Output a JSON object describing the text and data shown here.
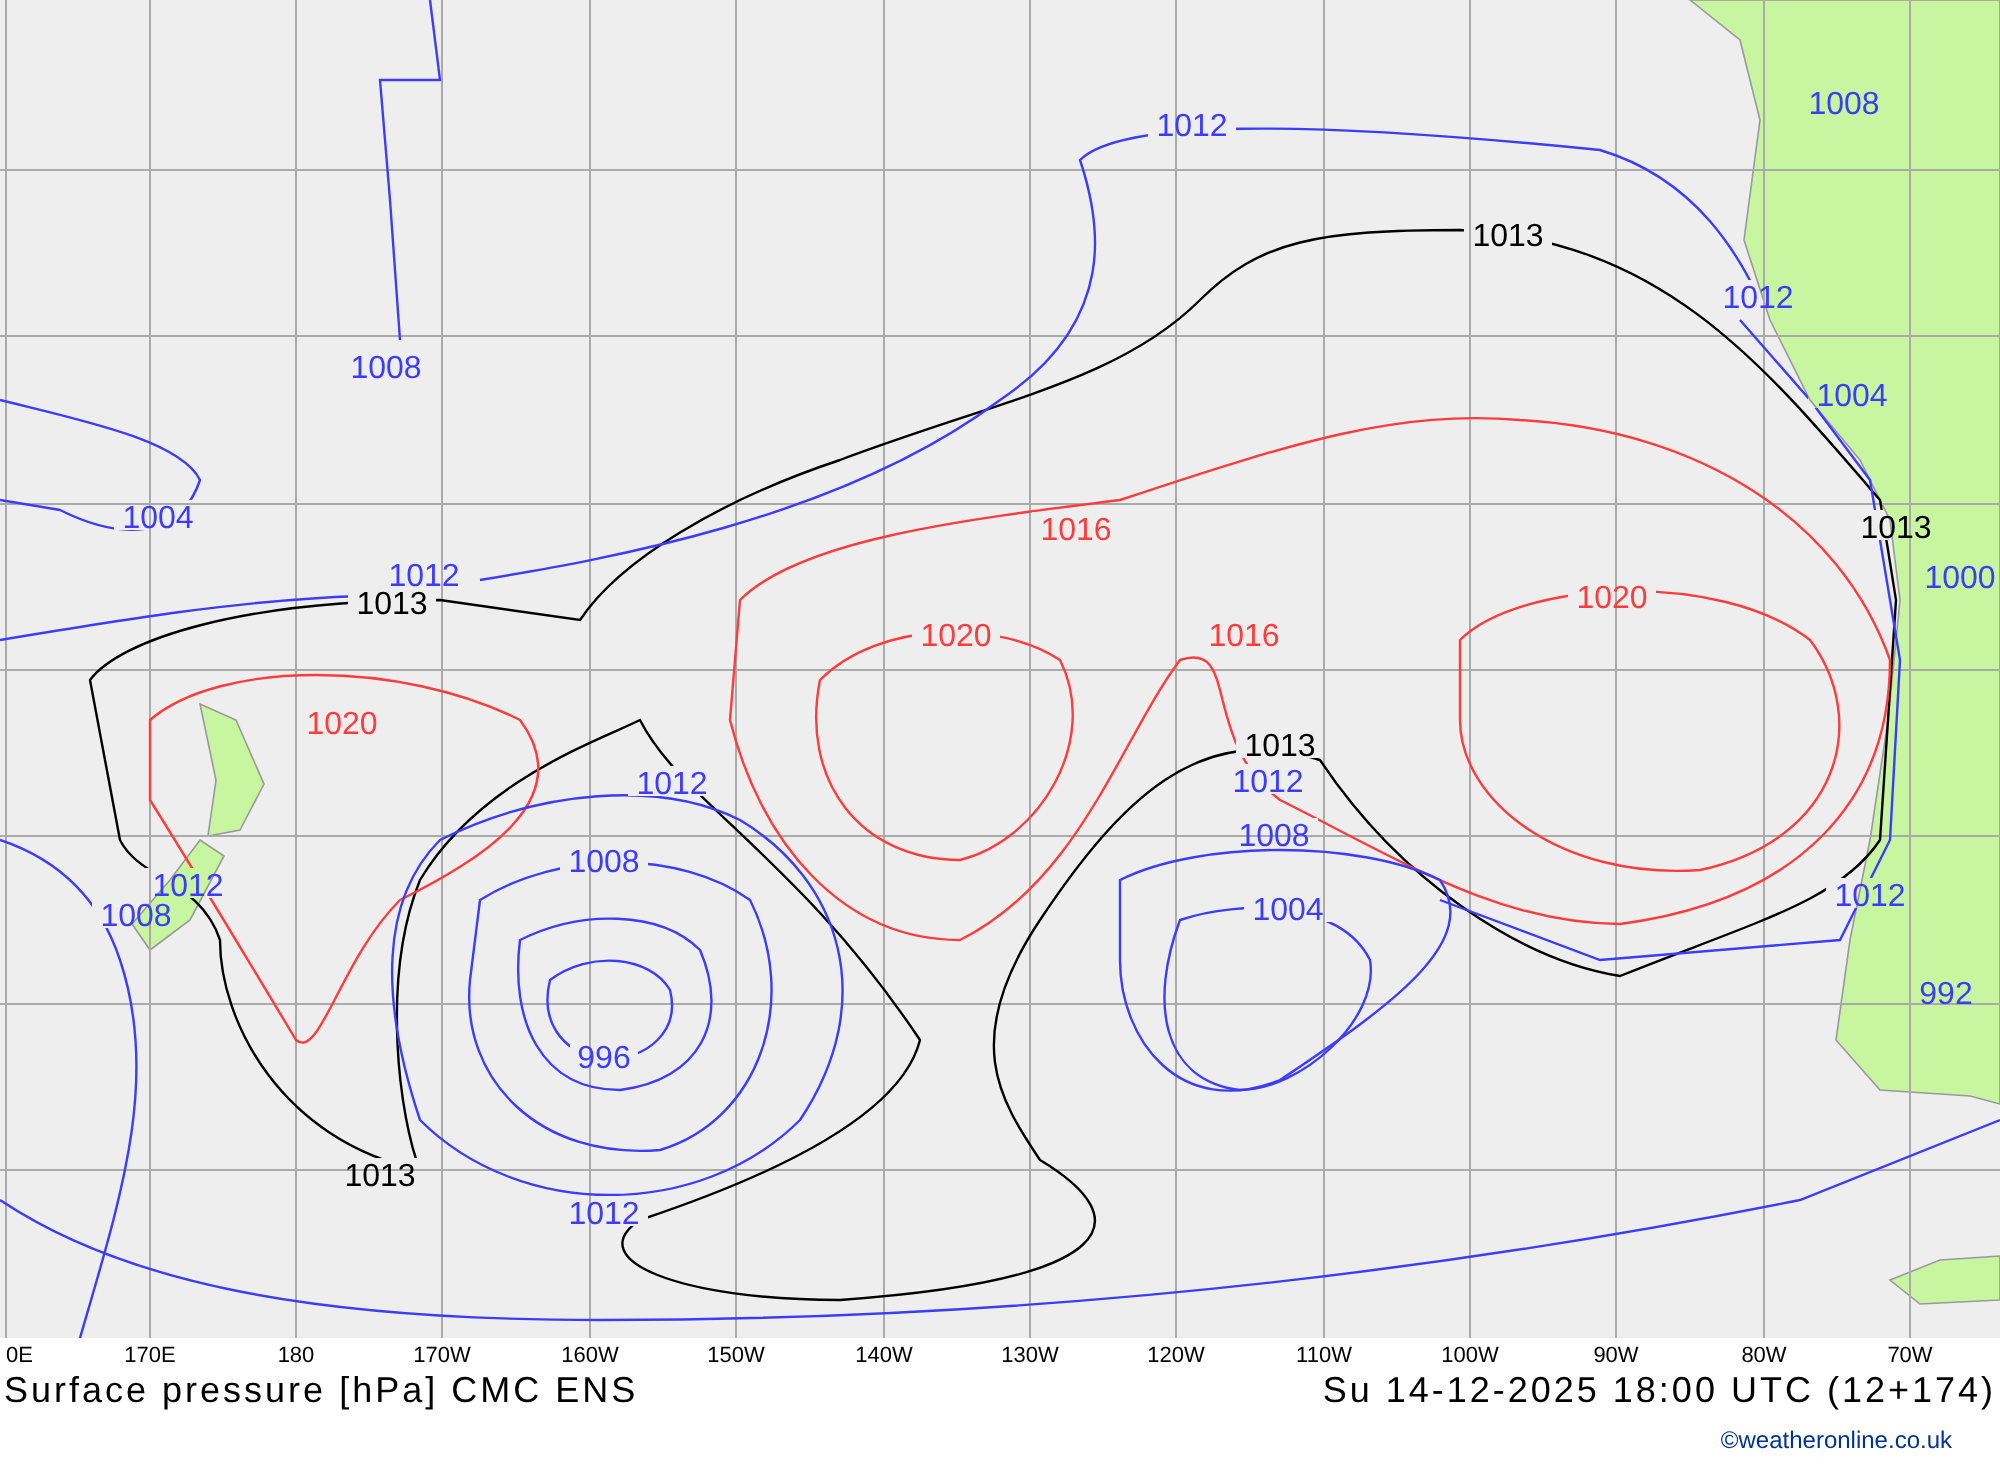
{
  "map": {
    "isobar_labels": [
      {
        "text": "1012",
        "color": "#3c3cff"
      },
      {
        "text": "1008",
        "color": "#3c3cff"
      },
      {
        "text": "1013",
        "color": "#000000"
      },
      {
        "text": "1012",
        "color": "#3c3cff"
      },
      {
        "text": "1008",
        "color": "#3c3cff"
      },
      {
        "text": "1004",
        "color": "#3c3cff"
      },
      {
        "text": "1004",
        "color": "#3c3cff"
      },
      {
        "text": "1016",
        "color": "#ff3c3c"
      },
      {
        "text": "1013",
        "color": "#000000"
      },
      {
        "text": "1012",
        "color": "#3c3cff"
      },
      {
        "text": "1000",
        "color": "#3c3cff"
      },
      {
        "text": "1020",
        "color": "#ff3c3c"
      },
      {
        "text": "1013",
        "color": "#000000"
      },
      {
        "text": "1020",
        "color": "#ff3c3c"
      },
      {
        "text": "1016",
        "color": "#ff3c3c"
      },
      {
        "text": "1020",
        "color": "#ff3c3c"
      },
      {
        "text": "1013",
        "color": "#000000"
      },
      {
        "text": "1012",
        "color": "#3c3cff"
      },
      {
        "text": "1012",
        "color": "#3c3cff"
      },
      {
        "text": "1008",
        "color": "#3c3cff"
      },
      {
        "text": "1008",
        "color": "#3c3cff"
      },
      {
        "text": "1012",
        "color": "#3c3cff"
      },
      {
        "text": "1012",
        "color": "#3c3cff"
      },
      {
        "text": "1008",
        "color": "#3c3cff"
      },
      {
        "text": "1004",
        "color": "#3c3cff"
      },
      {
        "text": "992",
        "color": "#3c3cff"
      },
      {
        "text": "996",
        "color": "#3c3cff"
      },
      {
        "text": "1013",
        "color": "#000000"
      },
      {
        "text": "1012",
        "color": "#3c3cff"
      }
    ],
    "longitude_labels": [
      "0E",
      "170E",
      "180",
      "170W",
      "160W",
      "150W",
      "140W",
      "130W",
      "120W",
      "110W",
      "100W",
      "90W",
      "80W",
      "70W"
    ]
  },
  "caption": {
    "title": "Surface pressure [hPa] CMC ENS",
    "valid_time": "Su 14-12-2025 18:00 UTC (12+174)"
  },
  "credit": "©weatheronline.co.uk"
}
